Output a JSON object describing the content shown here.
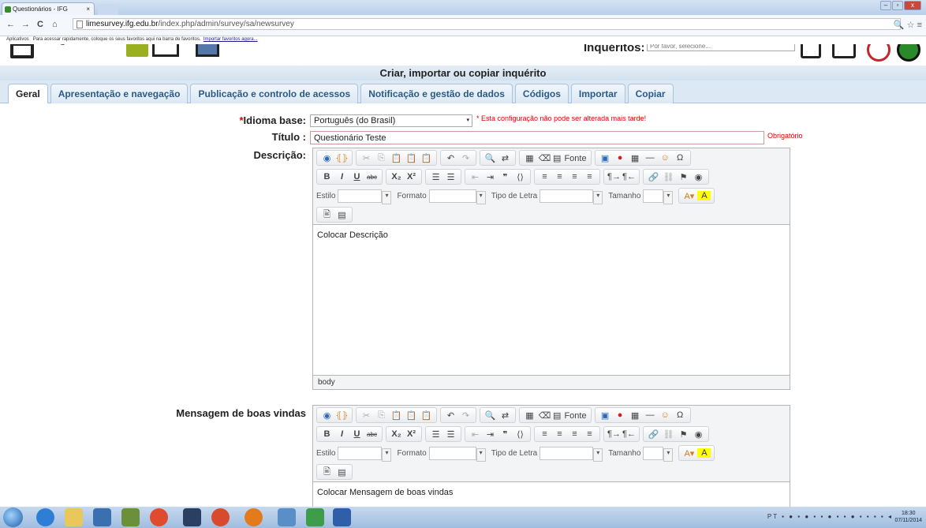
{
  "browser": {
    "tab_title": "Questionários - IFG",
    "tab_close": "×",
    "url_domain": "limesurvey.ifg.edu.br",
    "url_path": "/index.php/admin/survey/sa/newsurvey",
    "nav_back": "←",
    "nav_forward": "→",
    "nav_reload": "C",
    "nav_home": "⌂",
    "right_icons": "🔍 ☆ ≡",
    "bookmarks_prefix": "Aplicativos",
    "bookmarks_text": "Para acessar rapidamente, coloque os seus favoritos aqui na barra de favoritos.",
    "bookmarks_link": "Importar favoritos agora..."
  },
  "app": {
    "inqueritos_label": "Inquéritos:",
    "inqueritos_placeholder": "Por favor, selecione...",
    "page_title": "Criar, importar ou copiar inquérito"
  },
  "tabs": [
    {
      "label": "Geral",
      "active": true
    },
    {
      "label": "Apresentação e navegação"
    },
    {
      "label": "Publicação e controlo de acessos"
    },
    {
      "label": "Notificação e gestão de dados"
    },
    {
      "label": "Códigos"
    },
    {
      "label": "Importar"
    },
    {
      "label": "Copiar"
    }
  ],
  "form": {
    "required_mark": "*",
    "idioma_label": "Idioma base:",
    "idioma_value": "Português (do Brasil)",
    "idioma_warning": "* Esta configuração não pode ser alterada mais tarde!",
    "titulo_label": "Título :",
    "titulo_value": "Questionário Teste",
    "titulo_required": "Obrigatório",
    "descricao_label": "Descrição:",
    "descricao_content": "Colocar Descrição",
    "mensagem_label": "Mensagem de boas vindas",
    "mensagem_content": "Colocar Mensagem de boas vindas",
    "editor_path": "body"
  },
  "editor_toolbar": {
    "fonte": "Fonte",
    "estilo": "Estilo",
    "formato": "Formato",
    "tipo_letra": "Tipo de Letra",
    "tamanho": "Tamanho",
    "bold": "B",
    "italic": "I",
    "underline": "U",
    "strike": "abc",
    "sub": "X₂",
    "sup": "X²"
  },
  "taskbar": {
    "tray_lang": "PT",
    "time": "18:30",
    "date": "07/11/2014"
  }
}
